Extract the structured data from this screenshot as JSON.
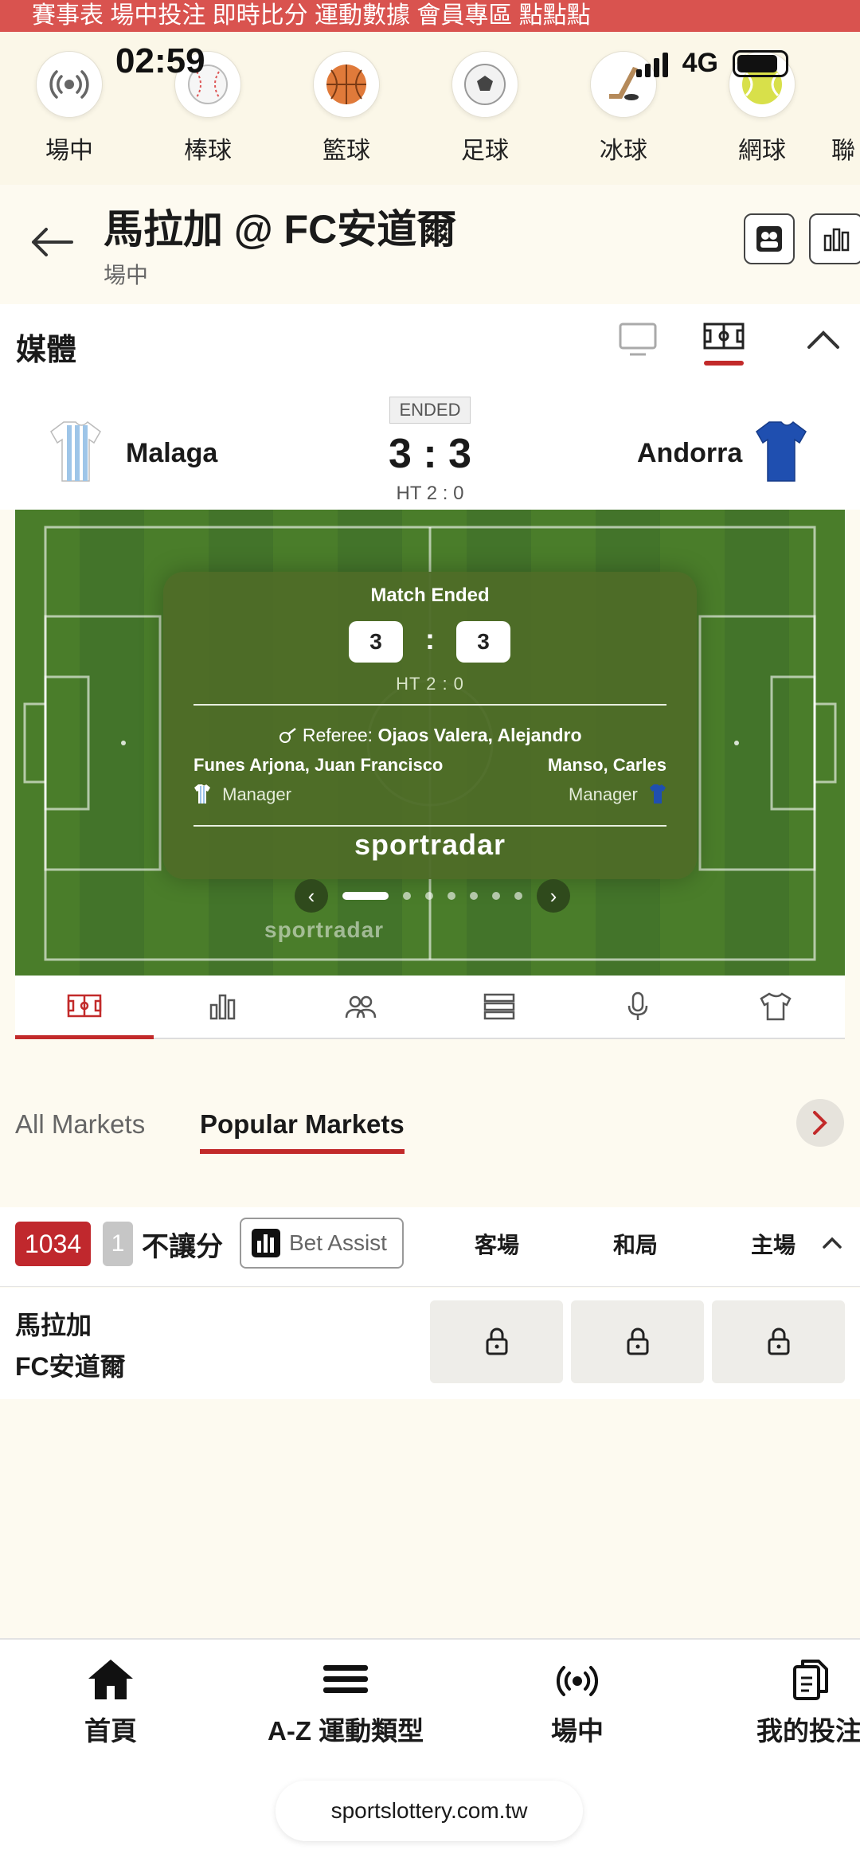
{
  "marquee": {
    "text": "賽事表    場中投注    即時比分    運動數據 會員專區 點點點"
  },
  "status": {
    "time": "02:59",
    "network": "4G"
  },
  "sports_nav": [
    {
      "label": "場中",
      "icon": "live-broadcast-icon"
    },
    {
      "label": "棒球",
      "icon": "baseball-icon"
    },
    {
      "label": "籃球",
      "icon": "basketball-icon"
    },
    {
      "label": "足球",
      "icon": "soccer-ball-icon"
    },
    {
      "label": "冰球",
      "icon": "ice-hockey-icon"
    },
    {
      "label": "網球",
      "icon": "tennis-ball-icon"
    },
    {
      "label": "聯",
      "icon": "more-sports-icon"
    }
  ],
  "header": {
    "title": "馬拉加 @ FC安道爾",
    "subtitle": "場中"
  },
  "media": {
    "title": "媒體"
  },
  "match": {
    "status": "ENDED",
    "home_team": "Malaga",
    "away_team": "Andorra",
    "score": "3 : 3",
    "halftime": "HT 2 : 0",
    "home_color": "#9ec5e8",
    "away_color": "#1f4fb0"
  },
  "widget": {
    "title": "Match Ended",
    "home_score": "3",
    "away_score": "3",
    "colon": ":",
    "halftime": "HT  2 : 0",
    "referee_label": "Referee:",
    "referee_name": "Ojaos Valera, Alejandro",
    "home_manager": "Funes Arjona, Juan Francisco",
    "away_manager": "Manso, Carles",
    "manager_label": "Manager",
    "brand": "sportradar",
    "pitch_colors": [
      "#4a7d2a",
      "#43742a"
    ]
  },
  "pitch_tabs": [
    "pitch-icon",
    "stats-bars-icon",
    "lineup-icon",
    "list-icon",
    "microphone-icon",
    "jersey-icon"
  ],
  "markets": {
    "tabs": [
      "All Markets",
      "Popular Markets"
    ],
    "active_tab": "Popular Markets"
  },
  "market": {
    "code": "1034",
    "count": "1",
    "name": "不讓分",
    "assist": "Bet Assist",
    "columns": [
      "客場",
      "和局",
      "主場"
    ],
    "teams": [
      "馬拉加",
      "FC安道爾"
    ]
  },
  "bottom_nav": [
    {
      "label": "首頁",
      "icon": "home-icon"
    },
    {
      "label": "A-Z 運動類型",
      "icon": "menu-icon"
    },
    {
      "label": "場中",
      "icon": "live-broadcast-icon"
    },
    {
      "label": "我的投注",
      "icon": "documents-icon"
    }
  ],
  "url": "sportslottery.com.tw",
  "accent_color": "#c22a2a"
}
